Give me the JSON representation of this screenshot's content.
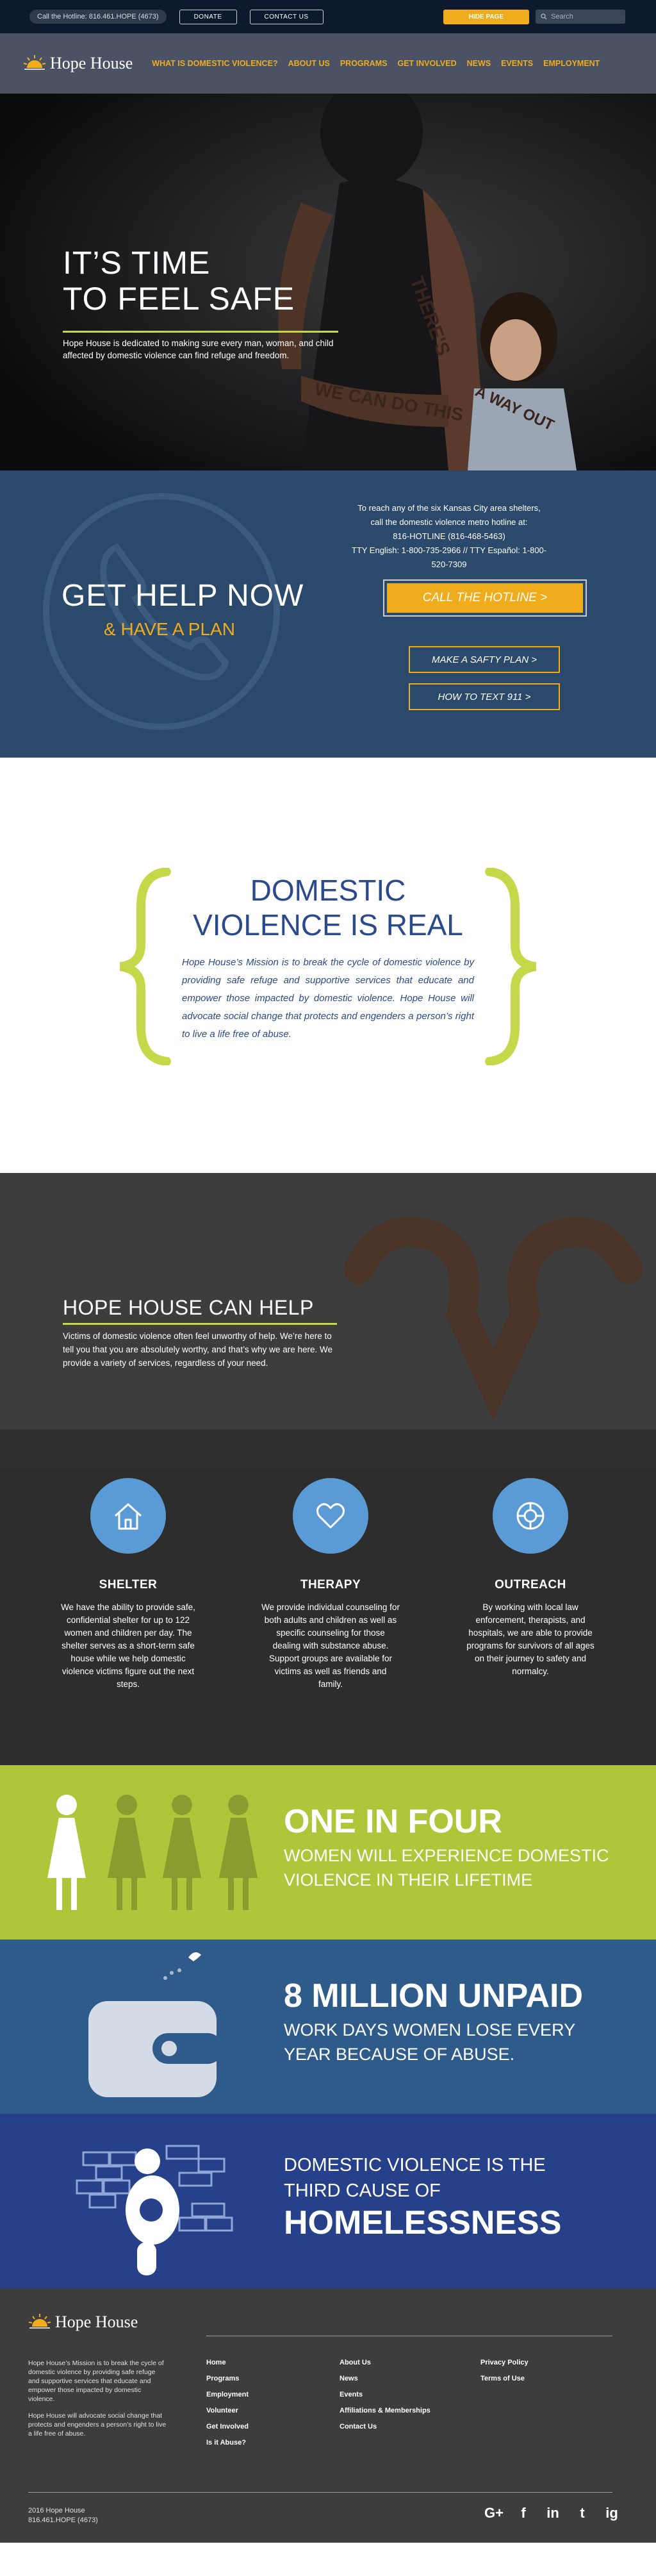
{
  "topbar": {
    "hotline_pill": "Call the Hotline: 816.461.HOPE (4673)",
    "donate": "DONATE",
    "contact": "CONTACT US",
    "hide_page": "HIDE PAGE",
    "search_placeholder": "Search"
  },
  "nav": {
    "logo": "Hope House",
    "items": [
      "WHAT IS DOMESTIC VIOLENCE?",
      "ABOUT US",
      "PROGRAMS",
      "GET INVOLVED",
      "NEWS",
      "EVENTS",
      "EMPLOYMENT"
    ]
  },
  "hero": {
    "line1": "IT’S TIME",
    "line2": "TO FEEL SAFE",
    "text": "Hope House is dedicated to making sure every man, woman, and child affected by domestic violence can find refuge and freedom.",
    "arm_text_1": "THERE'S",
    "arm_text_2": "A WAY OUT",
    "arm_text_3": "WE CAN DO THIS"
  },
  "help": {
    "title": "GET HELP NOW",
    "subtitle": "& HAVE A PLAN",
    "info1": "To reach any of the six Kansas City area shelters,",
    "info2": "call the domestic violence metro hotline at:",
    "info3": "816-HOTLINE (816-468-5463)",
    "info4": "TTY English: 1-800-735-2966  // TTY Español: 1-800-520-7309",
    "call_btn": "CALL THE HOTLINE >",
    "plan_btn": "MAKE A SAFTY PLAN >",
    "text_btn": "HOW TO TEXT 911 >"
  },
  "dv": {
    "title1": "DOMESTIC",
    "title2": "VIOLENCE IS REAL",
    "mission": "Hope House’s Mission is to break the cycle of domestic violence by providing safe refuge and supportive services that educate and empower those impacted by domestic violence. Hope House will advocate social change that protects and engenders a person’s right to live a life free of abuse."
  },
  "canhelp": {
    "title": "HOPE HOUSE CAN HELP",
    "intro": "Victims of domestic violence often feel unworthy of help. We’re here to tell you that you are absolutely worthy, and that’s why we are here. We provide a variety of services, regardless of your need.",
    "services": [
      {
        "title": "SHELTER",
        "text": "We have the ability to provide safe, confidential shelter for up to 122 women and children per day. The shelter serves as a short-term safe house while we help domestic violence victims figure out the next steps."
      },
      {
        "title": "THERAPY",
        "text": "We provide individual counseling for both adults and children as well as specific counseling for those dealing with substance abuse. Support groups are available for victims as well as friends and family."
      },
      {
        "title": "OUTREACH",
        "text": "By working with local law enforcement, therapists, and hospitals, we are able to provide programs for survivors of all ages on their journey to safety and normalcy."
      }
    ]
  },
  "stats": {
    "s1_title": "ONE IN FOUR",
    "s1_text": "WOMEN WILL EXPERIENCE DOMESTIC VIOLENCE IN THEIR LIFETIME",
    "s2_title": "8 MILLION UNPAID",
    "s2_text": "WORK DAYS WOMEN LOSE EVERY YEAR BECAUSE OF ABUSE.",
    "s3_line1": "DOMESTIC VIOLENCE IS THE",
    "s3_line2": "THIRD CAUSE OF",
    "s3_title": "HOMELESSNESS"
  },
  "footer": {
    "logo": "Hope House",
    "desc1": "Hope House’s Mission is to break the cycle of domestic violence by providing safe refuge and supportive services that educate and empower those impacted by domestic violence.",
    "desc2": "Hope House will advocate social change that protects and engenders a person’s right to live a life free of abuse.",
    "col1": [
      "Home",
      "Programs",
      "Employment",
      "Volunteer",
      "Get Involved",
      "Is it Abuse?"
    ],
    "col2": [
      "About Us",
      "News",
      "Events",
      "Affiliations & Memberships",
      "Contact Us"
    ],
    "col3": [
      "Privacy Policy",
      "Terms of Use"
    ],
    "copy1": "2016 Hope House",
    "copy2": "816.461.HOPE (4673)",
    "social": [
      "G+",
      "f",
      "in",
      "t",
      "ig"
    ]
  },
  "colors": {
    "accent": "#efac1d",
    "lime": "#c5d84a",
    "navy": "#2b4a6b",
    "blue": "#5b9bd5"
  }
}
